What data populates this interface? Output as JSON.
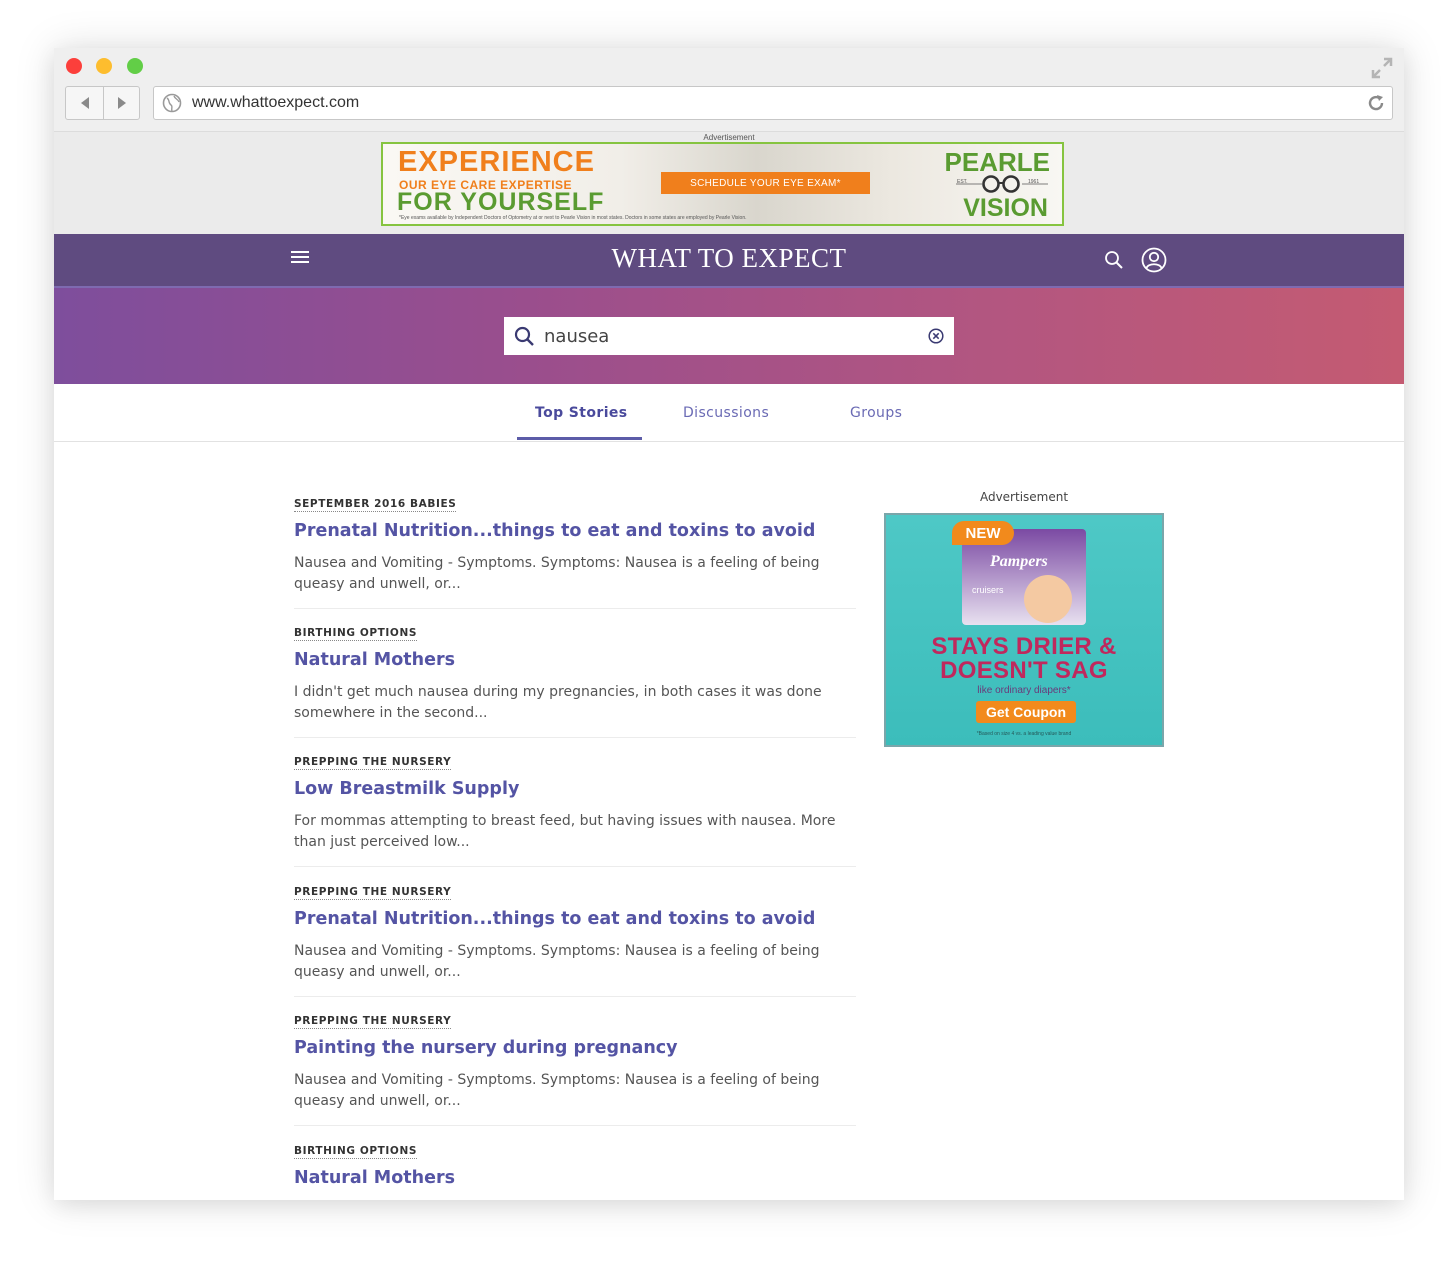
{
  "browser": {
    "url": "www.whattoexpect.com"
  },
  "top_ad": {
    "label": "Advertisement",
    "headline_1": "EXPERIENCE",
    "headline_2": "OUR EYE CARE EXPERTISE",
    "headline_3": "FOR YOURSELF",
    "cta": "SCHEDULE YOUR EYE EXAM*",
    "fine_print": "*Eye exams available by Independent Doctors of Optometry at or next to Pearle Vision in most states. Doctors in some states are employed by Pearle Vision.",
    "brand_1": "PEARLE",
    "brand_est": "EST. 1961",
    "brand_2": "VISION"
  },
  "header": {
    "logo": "WHAT TO EXPECT"
  },
  "search": {
    "value": "nausea",
    "placeholder": "Search"
  },
  "tabs": [
    {
      "label": "Top Stories"
    },
    {
      "label": "Discussions"
    },
    {
      "label": "Groups"
    }
  ],
  "results": [
    {
      "category": "SEPTEMBER 2016 BABIES",
      "title": "Prenatal Nutrition...things to eat and toxins to avoid",
      "snippet": "Nausea and Vomiting - Symptoms. Symptoms: Nausea is a feeling of being queasy and unwell, or..."
    },
    {
      "category": "BIRTHING OPTIONS",
      "title": "Natural Mothers",
      "snippet": "I didn't get much nausea during my pregnancies, in both cases it was done somewhere in the second..."
    },
    {
      "category": "PREPPING THE NURSERY",
      "title": "Low Breastmilk Supply",
      "snippet": "For mommas attempting to breast feed, but having issues with nausea. More than just perceived low..."
    },
    {
      "category": "PREPPING THE NURSERY",
      "title": "Prenatal Nutrition...things to eat and toxins to avoid",
      "snippet": "Nausea and Vomiting - Symptoms. Symptoms: Nausea is a feeling of being queasy and unwell, or..."
    },
    {
      "category": "PREPPING THE NURSERY",
      "title": "Painting the nursery during pregnancy",
      "snippet": "Nausea and Vomiting - Symptoms. Symptoms: Nausea is a feeling of being queasy and unwell, or..."
    },
    {
      "category": "BIRTHING OPTIONS",
      "title": "Natural Mothers",
      "snippet": ""
    }
  ],
  "side_ad": {
    "label": "Advertisement",
    "badge": "NEW",
    "brand": "Pampers",
    "product": "cruisers",
    "headline_1": "STAYS DRIER &",
    "headline_2": "DOESN'T SAG",
    "subline": "like ordinary diapers*",
    "cta": "Get Coupon",
    "fine_print": "*Based on size 4 vs. a leading value brand"
  },
  "colors": {
    "header_bg": "#5f4b80",
    "accent": "#5454a4",
    "hero_start": "#7e4e9c",
    "hero_end": "#c45b72"
  }
}
